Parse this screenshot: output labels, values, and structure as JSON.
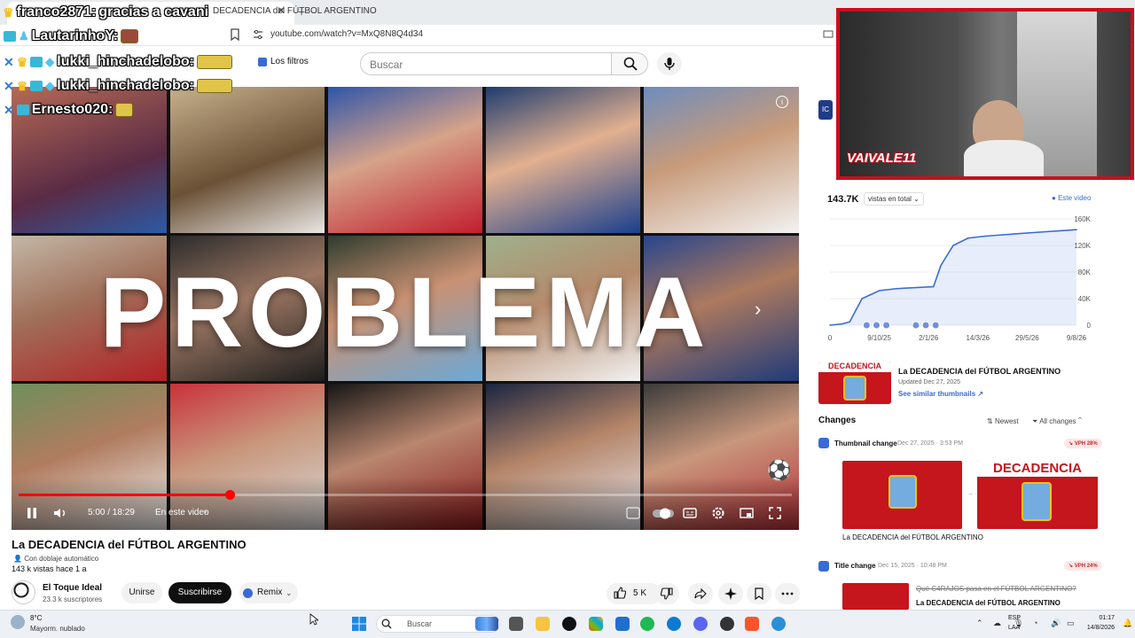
{
  "browser": {
    "tab_title": "DECADENCIA del FÚTBOL ARGENTINO",
    "url": "youtube.com/watch?v=MxQ8N8Q4d34"
  },
  "chat": [
    {
      "user": "franco2871:",
      "text": "gracias a cavani"
    },
    {
      "user": "LautarinhoY:",
      "text": ""
    },
    {
      "user": "lukki_hinchadelobo:",
      "text": ""
    },
    {
      "user": "lukki_hinchadelobo:",
      "text": ""
    },
    {
      "user": "Ernesto020:",
      "text": ""
    }
  ],
  "header": {
    "search_placeholder": "Buscar",
    "filters_label": "Los filtros"
  },
  "video": {
    "overlay_word": "PROBLEMA",
    "progress": 0.273,
    "time": "5:00 / 18:29",
    "chapter": "En este video"
  },
  "meta": {
    "title": "La DECADENCIA del FÚTBOL ARGENTINO",
    "dubbing": "Con doblaje automático",
    "views": "143 k vistas  hace 1 a",
    "channel": "El Toque Ideal",
    "subscribers": "23.3 k suscriptores",
    "join": "Unirse",
    "subscribe": "Suscribirse",
    "remix": "Remix",
    "likes": "5 K"
  },
  "panel": {
    "badge": "IC",
    "total": "143.7K",
    "total_select": "vistas en total",
    "legend": "Este video",
    "thumb_title": "La DECADENCIA del FÚTBOL ARGENTINO",
    "thumb_updated": "Updated Dec 27, 2025",
    "thumb_similar": "See similar thumbnails",
    "thumb_text": "DECADENCIA",
    "changes_title": "Changes",
    "sort_newest": "Newest",
    "sort_all": "All changes",
    "change1": {
      "label": "Thumbnail change",
      "date": "Dec 27, 2025 · 3:53 PM",
      "vph": "VPH 28%",
      "caption": "La DECADENCIA del FÚTBOL ARGENTINO",
      "after_text": "DECADENCIA"
    },
    "change2": {
      "label": "Title change",
      "date": "Dec 15, 2025 · 10:48 PM",
      "vph": "VPH 24%",
      "old": "Qué C4RAJOS pasa en el FÚTBOL ARGENTINO?",
      "new": "La DECADENCIA del FÚTBOL ARGENTINO"
    }
  },
  "chart_data": {
    "type": "area",
    "x_ticks": [
      "0",
      "9/10/25",
      "2/1/26",
      "14/3/26",
      "29/5/26",
      "9/8/26"
    ],
    "y_ticks": [
      "0",
      "40K",
      "80K",
      "120K",
      "160K"
    ],
    "ylim": [
      0,
      160000
    ],
    "x": [
      0,
      0.05,
      0.08,
      0.13,
      0.2,
      0.27,
      0.42,
      0.45,
      0.5,
      0.56,
      0.63,
      0.7,
      0.85,
      1.0
    ],
    "values": [
      0,
      2000,
      5000,
      40000,
      52000,
      55000,
      58000,
      90000,
      120000,
      131000,
      134000,
      136000,
      140000,
      143700
    ],
    "series_color": "#3a6ad6"
  },
  "webcam": {
    "logo": "VAIVALE11"
  },
  "taskbar": {
    "weather_temp": "8°C",
    "weather_desc": "Mayorm. nublado",
    "search": "Buscar",
    "lang1": "ESP",
    "lang2": "LAA",
    "time": "01:17",
    "date": "14/8/2026"
  }
}
